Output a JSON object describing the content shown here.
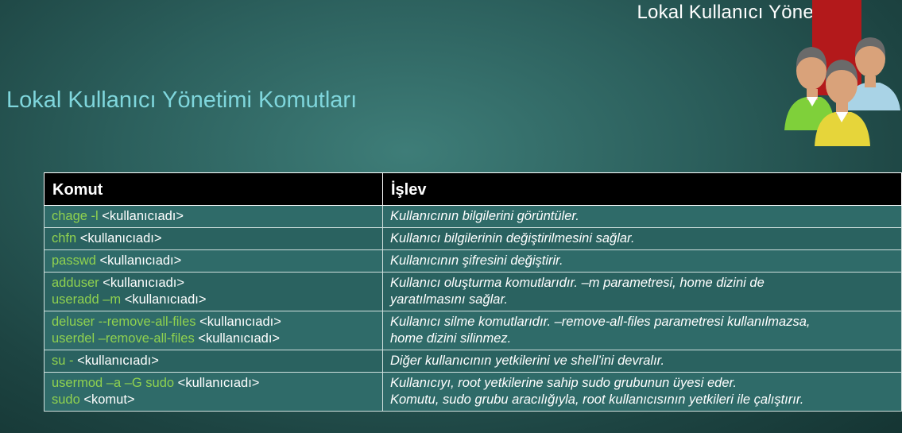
{
  "header": {
    "title": "Lokal Kullanıcı Yönetimi"
  },
  "slide": {
    "title": "Lokal Kullanıcı Yönetimi Komutları"
  },
  "table": {
    "columns": [
      "Komut",
      "İşlev"
    ],
    "rows": [
      {
        "cmd": [
          {
            "green": "chage -l",
            "rest": " <kullanıcıadı>"
          }
        ],
        "desc": [
          "Kullanıcının bilgilerini görüntüler."
        ]
      },
      {
        "cmd": [
          {
            "green": "chfn",
            "rest": " <kullanıcıadı>"
          }
        ],
        "desc": [
          "Kullanıcı bilgilerinin değiştirilmesini sağlar."
        ]
      },
      {
        "cmd": [
          {
            "green": "passwd",
            "rest": " <kullanıcıadı>"
          }
        ],
        "desc": [
          "Kullanıcının şifresini değiştirir."
        ]
      },
      {
        "cmd": [
          {
            "green": "adduser",
            "rest": " <kullanıcıadı>"
          },
          {
            "green": "useradd –m",
            "rest": " <kullanıcıadı>"
          }
        ],
        "desc": [
          "Kullanıcı oluşturma komutlarıdır. –m parametresi, home dizini de",
          "yaratılmasını sağlar."
        ]
      },
      {
        "cmd": [
          {
            "green": "deluser --remove-all-files",
            "rest": " <kullanıcıadı>"
          },
          {
            "green": "userdel –remove-all-files",
            "rest": " <kullanıcıadı>"
          }
        ],
        "desc": [
          "Kullanıcı silme komutlarıdır. –remove-all-files parametresi kullanılmazsa,",
          "home dizini silinmez."
        ]
      },
      {
        "cmd": [
          {
            "green": "su -",
            "rest": " <kullanıcıadı>"
          }
        ],
        "desc": [
          "Diğer kullanıcının yetkilerini ve shell’ini devralır."
        ]
      },
      {
        "cmd": [
          {
            "green": "usermod –a –G sudo",
            "rest": " <kullanıcıadı>"
          },
          {
            "green": "sudo",
            "rest": " <komut>"
          }
        ],
        "desc": [
          "Kullanıcıyı, root yetkilerine sahip sudo grubunun üyesi eder.",
          "Komutu, sudo grubu aracılığıyla, root kullanıcısının yetkileri ile çalıştırır."
        ]
      }
    ]
  },
  "colors": {
    "command_green": "#8fd14f",
    "title_cyan": "#7fd6dc",
    "band_red": "#b3191b"
  },
  "icons": {
    "users": "users-group-icon"
  }
}
